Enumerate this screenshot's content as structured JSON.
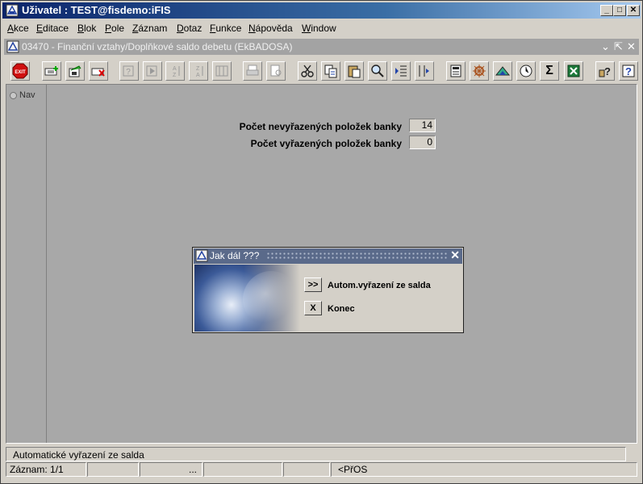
{
  "window": {
    "title": "Uživatel : TEST@fisdemo:iFIS",
    "buttons": {
      "minimize": "_",
      "maximize": "□",
      "close": "✕"
    }
  },
  "menu": [
    {
      "label": "Akce",
      "underline": "A",
      "rest": "kce"
    },
    {
      "label": "Editace",
      "underline": "E",
      "rest": "ditace"
    },
    {
      "label": "Blok",
      "underline": "B",
      "rest": "lok"
    },
    {
      "label": "Pole",
      "underline": "P",
      "rest": "ole"
    },
    {
      "label": "Záznam",
      "underline": "Z",
      "rest": "áznam"
    },
    {
      "label": "Dotaz",
      "underline": "D",
      "rest": "otaz"
    },
    {
      "label": "Funkce",
      "underline": "F",
      "rest": "unkce"
    },
    {
      "label": "Nápověda",
      "underline": "N",
      "rest": "ápověda"
    },
    {
      "label": "Window",
      "underline": "W",
      "rest": "indow"
    }
  ],
  "form": {
    "title": "03470 - Finanční vztahy/Doplňkové saldo debetu (EkBADOSA)",
    "nav_label": "Nav",
    "fields": [
      {
        "label": "Počet nevyřazených položek banky",
        "value": "14"
      },
      {
        "label": "Počet vyřazených položek banky",
        "value": "0"
      }
    ]
  },
  "toolbar": {
    "exit_label": "EXIT",
    "icons": [
      "exit-icon",
      "add-record-icon",
      "save-icon",
      "delete-record-icon",
      "query-icon",
      "execute-query-icon",
      "sort-az-icon",
      "sort-za-icon",
      "sort-multi-icon",
      "print-icon",
      "print-preview-icon",
      "cut-icon",
      "copy-icon",
      "paste-icon",
      "find-icon",
      "indent-icon",
      "columns-icon",
      "calculator-icon",
      "settings-icon",
      "chart-icon",
      "clock-icon",
      "sum-icon",
      "excel-icon",
      "help-icon",
      "context-help-icon"
    ],
    "sum_glyph": "Σ",
    "help_glyph": "?"
  },
  "dialog": {
    "title": "Jak dál ???",
    "close_glyph": "✕",
    "options": [
      {
        "button": ">>",
        "label": "Autom.vyřazení ze salda"
      },
      {
        "button": "X",
        "label": "Konec"
      }
    ]
  },
  "status": {
    "message": "Automatické vyřazení ze salda",
    "record": "Záznam: 1/1",
    "ellipsis": "...",
    "mode": "<PřOS"
  },
  "colors": {
    "titlebar_start": "#0a246a",
    "canvas": "#a8a8a8",
    "dialog_title": "#5a6a8a"
  }
}
